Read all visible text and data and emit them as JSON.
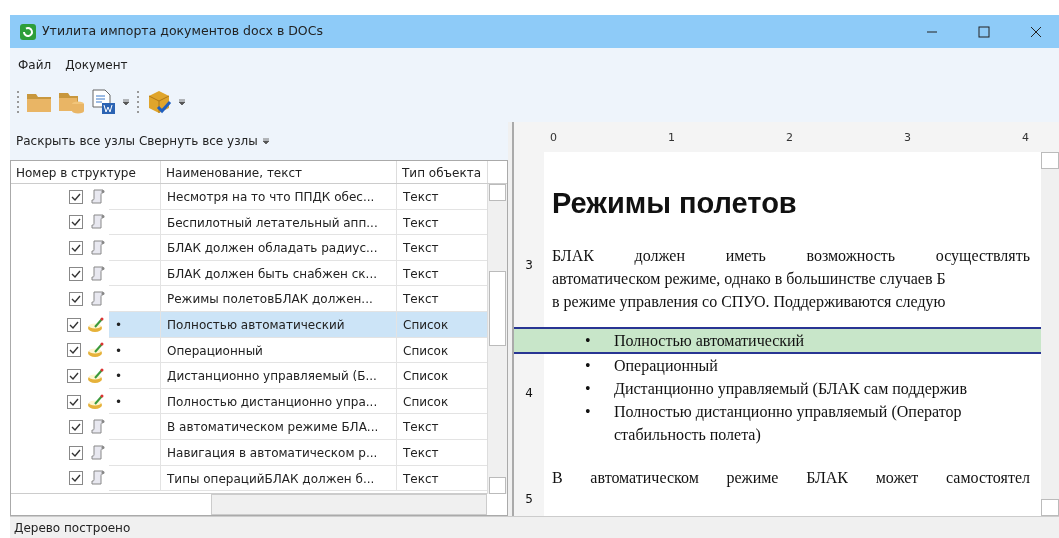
{
  "window": {
    "title": "Утилита импорта документов docx в DOCs"
  },
  "menu": [
    "Файл",
    "Документ"
  ],
  "tree_toolbar": [
    "Раскрыть все узлы",
    "Свернуть все узлы"
  ],
  "table": {
    "columns": [
      "Номер в структуре",
      "Наименование, текст",
      "Тип объекта"
    ],
    "rows": [
      {
        "kind": "text",
        "checked": true,
        "selected": false,
        "name": "Несмотря на то что ППДК обес...",
        "type": "Текст"
      },
      {
        "kind": "text",
        "checked": true,
        "selected": false,
        "name": "Беспилотный летательный апп...",
        "type": "Текст"
      },
      {
        "kind": "text",
        "checked": true,
        "selected": false,
        "name": "БЛАК должен обладать радиус...",
        "type": "Текст"
      },
      {
        "kind": "text",
        "checked": true,
        "selected": false,
        "name": "БЛАК должен быть снабжен ск...",
        "type": "Текст"
      },
      {
        "kind": "text",
        "checked": true,
        "selected": false,
        "name": "Режимы полетовБЛАК должен...",
        "type": "Текст"
      },
      {
        "kind": "list",
        "checked": true,
        "selected": true,
        "bullet": "•",
        "name": "Полностью автоматический",
        "type": "Список"
      },
      {
        "kind": "list",
        "checked": true,
        "selected": false,
        "bullet": "•",
        "name": "Операционный",
        "type": "Список"
      },
      {
        "kind": "list",
        "checked": true,
        "selected": false,
        "bullet": "•",
        "name": "Дистанционно управляемый (Б...",
        "type": "Список"
      },
      {
        "kind": "list",
        "checked": true,
        "selected": false,
        "bullet": "•",
        "name": "Полностью дистанционно упра...",
        "type": "Список"
      },
      {
        "kind": "text",
        "checked": true,
        "selected": false,
        "name": "В автоматическом режиме БЛА...",
        "type": "Текст"
      },
      {
        "kind": "text",
        "checked": true,
        "selected": false,
        "name": "Навигация в автоматическом р...",
        "type": "Текст"
      },
      {
        "kind": "text",
        "checked": true,
        "selected": false,
        "name": "Типы операцийБЛАК должен б...",
        "type": "Текст"
      }
    ]
  },
  "ruler": {
    "labels": [
      "0",
      "1",
      "2",
      "3",
      "4"
    ]
  },
  "vertical_ruler": {
    "labels": [
      "3",
      "4",
      "5"
    ]
  },
  "document": {
    "heading": "Режимы полетов",
    "paragraph_lines": [
      "БЛАК должен иметь возможность осуществлять",
      "автоматическом режиме, однако в большинстве случаев Б",
      "в режиме управления со СПУО. Поддерживаются следую"
    ],
    "list": [
      {
        "bullet": "•",
        "selected": true,
        "lines": [
          "Полностью автоматический"
        ]
      },
      {
        "bullet": "•",
        "selected": false,
        "lines": [
          "Операционный"
        ]
      },
      {
        "bullet": "•",
        "selected": false,
        "lines": [
          "Дистанционно управляемый (БЛАК сам поддержив"
        ]
      },
      {
        "bullet": "•",
        "selected": false,
        "lines": [
          "Полностью дистанционно управляемый (Оператор",
          "стабильность полета)"
        ]
      }
    ],
    "last_line": "В автоматическом режиме БЛАК может самостоятел"
  },
  "status_bar": "Дерево построено"
}
